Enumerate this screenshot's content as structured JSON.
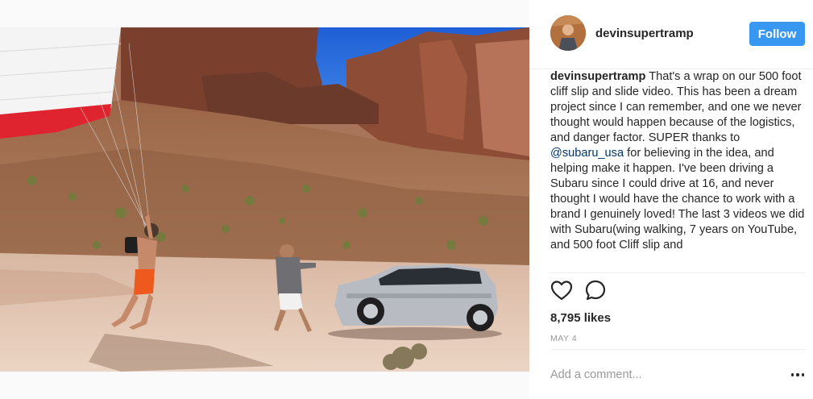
{
  "post": {
    "username": "devinsupertramp",
    "follow_label": "Follow",
    "caption": {
      "username": "devinsupertramp",
      "text_before_mention": " That's a wrap on our 500 foot cliff slip and slide video. This has been a dream project since I can remember, and one we never thought would happen because of the logistics, and danger factor. SUPER thanks to ",
      "mention": "@subaru_usa",
      "text_after_mention": " for believing in the idea, and helping make it happen. I've been driving a Subaru since I could drive at 16, and never thought I would have the chance to work with a brand I genuinely loved! The last 3 videos we did with Subaru(wing walking, 7 years on YouTube, and 500 foot Cliff slip and"
    },
    "likes": "8,795 likes",
    "date": "MAY 4",
    "comment_placeholder": "Add a comment...",
    "icons": {
      "like": "heart-icon",
      "comment": "speech-bubble-icon",
      "more": "more-options-icon"
    },
    "colors": {
      "follow_button": "#3897f0",
      "mention": "#003569"
    }
  }
}
